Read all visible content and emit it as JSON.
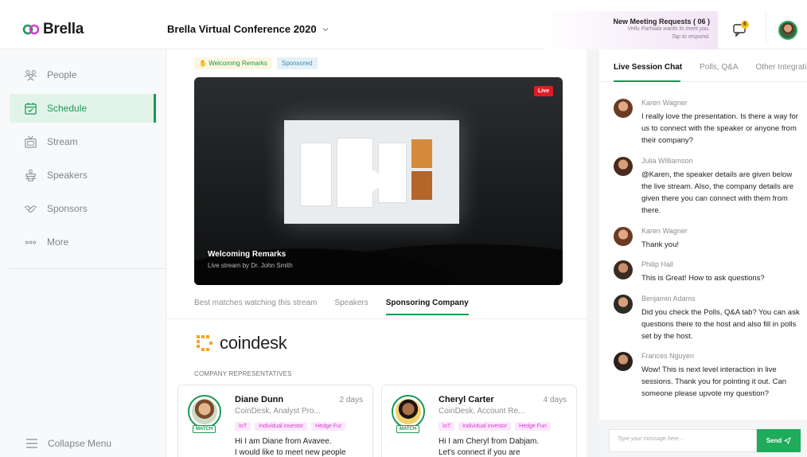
{
  "brand": {
    "name": "Brella"
  },
  "header": {
    "event_name": "Brella Virtual Conference 2020",
    "notification": {
      "title": "New Meeting Requests ( 06 )",
      "line1": "Vellu Parhiala wants to meet you.",
      "line2": "Tap to respond."
    },
    "bell_badge": "6"
  },
  "sidebar": {
    "items": [
      {
        "label": "People",
        "icon": "people-icon"
      },
      {
        "label": "Schedule",
        "icon": "calendar-icon",
        "active": true
      },
      {
        "label": "Stream",
        "icon": "tv-icon"
      },
      {
        "label": "Speakers",
        "icon": "podium-icon"
      },
      {
        "label": "Sponsors",
        "icon": "handshake-icon"
      },
      {
        "label": "More",
        "icon": "more-icon"
      }
    ],
    "collapse_label": "Collapse Menu"
  },
  "main": {
    "tags": [
      "Welcoming Remarks",
      "Sponsored"
    ],
    "video": {
      "title": "Welcoming Remarks",
      "subtitle": "Live stream by Dr. John Smith",
      "live_badge": "Live"
    },
    "tabs": [
      "Best matches watching this stream",
      "Speakers",
      "Sponsoring Company"
    ],
    "active_tab": "Sponsoring Company",
    "sponsor_name": "coindesk",
    "reps_label": "COMPANY REPRESENTATIVES",
    "representatives": [
      {
        "name": "Diane Dunn",
        "time": "2 days",
        "company": "CoinDesk, Analyst Pro...",
        "tags": [
          "IoT",
          "Individual investor",
          "Hedge Fur"
        ],
        "match": "MATCH",
        "message_line1": "Hi I am Diane from Avavee.",
        "message_line2": "I would like to meet new people"
      },
      {
        "name": "Cheryl Carter",
        "time": "4 days",
        "company": "CoinDesk, Account Re...",
        "tags": [
          "IoT",
          "Individual investor",
          "Hedge Fun"
        ],
        "match": "MATCH",
        "message_line1": "Hi I am Cheryl from Dabjam.",
        "message_line2": "Let's connect if you are"
      }
    ]
  },
  "chat": {
    "tabs": [
      "Live Session Chat",
      "Polls, Q&A",
      "Other Integrati"
    ],
    "messages": [
      {
        "name": "Karen Wagner",
        "text": "I really love the presentation. Is there a way for us to connect with the speaker or anyone from their company?"
      },
      {
        "name": "Julia Williamson",
        "text": "@Karen, the speaker details are given below the live stream. Also, the company details are given there you can connect with them from there."
      },
      {
        "name": "Karen Wagner",
        "text": "Thank you!"
      },
      {
        "name": "Philip Hall",
        "text": "This is Great! How to ask questions?"
      },
      {
        "name": "Benjamin Adams",
        "text": "Did you check the Polls, Q&A tab? You can ask questions there to the host and also fill in polls set by the host."
      },
      {
        "name": "Frances Nguyen",
        "text": "Wow! This is next level interaction in live sessions. Thank you for pointing it out. Can someone please upvote my question?"
      }
    ],
    "input_placeholder": "Type your message here...",
    "send_label": "Send"
  },
  "colors": {
    "accent": "#1a9a55",
    "live": "#e11b22",
    "tag_pink": "#d13fd2"
  }
}
